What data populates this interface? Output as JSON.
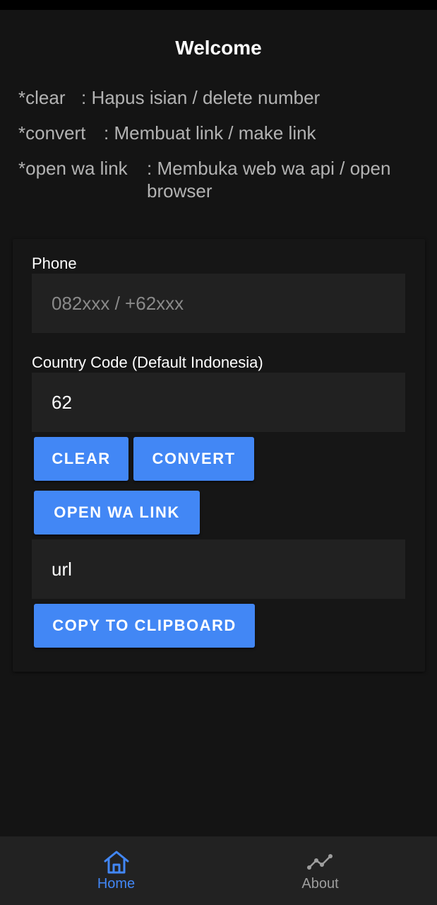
{
  "header": {
    "title": "Welcome"
  },
  "help": [
    {
      "key": "*clear",
      "desc": ": Hapus isian / delete number"
    },
    {
      "key": "*convert",
      "desc": ": Membuat link / make link"
    },
    {
      "key": "*open wa link",
      "desc": ": Membuka web wa api / open\nbrowser"
    }
  ],
  "form": {
    "phone": {
      "label": "Phone",
      "value": "",
      "placeholder": "082xxx / +62xxx"
    },
    "country_code": {
      "label": "Country Code (Default Indonesia)",
      "value": "62"
    },
    "buttons": {
      "clear": "CLEAR",
      "convert": "CONVERT",
      "open_wa_link": "OPEN WA LINK",
      "copy": "COPY TO CLIPBOARD"
    },
    "url": {
      "value": "url"
    }
  },
  "nav": {
    "home": {
      "label": "Home",
      "icon": "home-icon",
      "active": true
    },
    "about": {
      "label": "About",
      "icon": "trend-icon",
      "active": false
    }
  },
  "colors": {
    "background": "#141414",
    "card": "#161616",
    "field": "#212121",
    "accent": "#4287f5",
    "muted_text": "#b3b3b3",
    "nav_bg": "#222222",
    "nav_inactive": "#9e9e9e"
  }
}
